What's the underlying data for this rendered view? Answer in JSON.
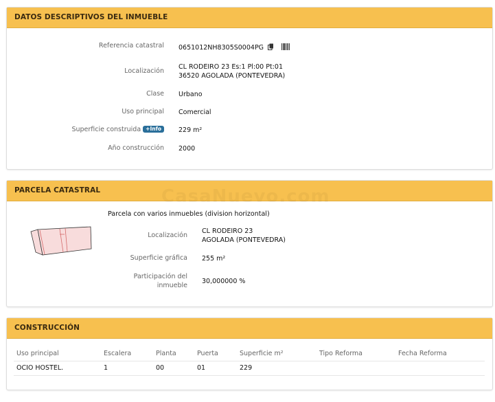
{
  "descriptivos": {
    "title": "DATOS DESCRIPTIVOS DEL INMUEBLE",
    "ref_label": "Referencia catastral",
    "ref_value": "0651012NH8305S0004PG",
    "loc_label": "Localización",
    "loc_line1": "CL RODEIRO 23 Es:1 Pl:00 Pt:01",
    "loc_line2": "36520 AGOLADA (PONTEVEDRA)",
    "clase_label": "Clase",
    "clase_value": "Urbano",
    "uso_label": "Uso principal",
    "uso_value": "Comercial",
    "sup_label": "Superficie construida",
    "info_badge": "+Info",
    "sup_value": "229 m²",
    "anio_label": "Año construcción",
    "anio_value": "2000"
  },
  "parcela": {
    "title": "PARCELA CATASTRAL",
    "desc": "Parcela con varios inmuebles (division horizontal)",
    "loc_label": "Localización",
    "loc_line1": "CL RODEIRO 23",
    "loc_line2": "AGOLADA (PONTEVEDRA)",
    "sup_label": "Superficie gráfica",
    "sup_value": "255 m²",
    "part_label_line1": "Participación del",
    "part_label_line2": "inmueble",
    "part_value": "30,000000 %",
    "watermark": "CasaNuevo.com"
  },
  "construccion": {
    "title": "CONSTRUCCIÓN",
    "headers": [
      "Uso principal",
      "Escalera",
      "Planta",
      "Puerta",
      "Superficie m²",
      "Tipo Reforma",
      "Fecha Reforma"
    ],
    "rows": [
      [
        "OCIO HOSTEL.",
        "1",
        "00",
        "01",
        "229",
        "",
        ""
      ]
    ]
  },
  "colors": {
    "header_bg": "#f7c04f",
    "badge_bg": "#2a6f9a"
  },
  "icons": [
    "copy-icon",
    "barcode-icon"
  ]
}
